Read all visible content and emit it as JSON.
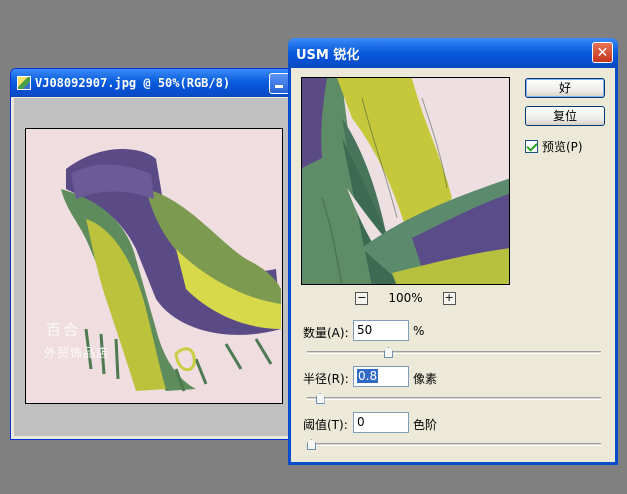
{
  "document_window": {
    "title": "VJ08092907.jpg @ 50%(RGB/8)",
    "watermark_line1": "百合",
    "watermark_line2": "外贸饰品店"
  },
  "dialog": {
    "title": "USM 锐化",
    "ok_label": "好",
    "reset_label": "复位",
    "preview_label": "预览(P)",
    "preview_checked": true,
    "zoom_out": "−",
    "zoom_level": "100%",
    "zoom_in": "+",
    "amount": {
      "label": "数量(A):",
      "value": "50",
      "unit": "%",
      "slider_fraction": 0.27
    },
    "radius": {
      "label": "半径(R):",
      "value": "0.8",
      "unit": "像素",
      "slider_fraction": 0.03
    },
    "threshold": {
      "label": "阈值(T):",
      "value": "0",
      "unit": "色阶",
      "slider_fraction": 0.0
    }
  },
  "colors": {
    "title_bar": "#0a5ddc",
    "desktop": "#808080",
    "dialog_face": "#ece9d8",
    "close_button": "#c4351c"
  }
}
